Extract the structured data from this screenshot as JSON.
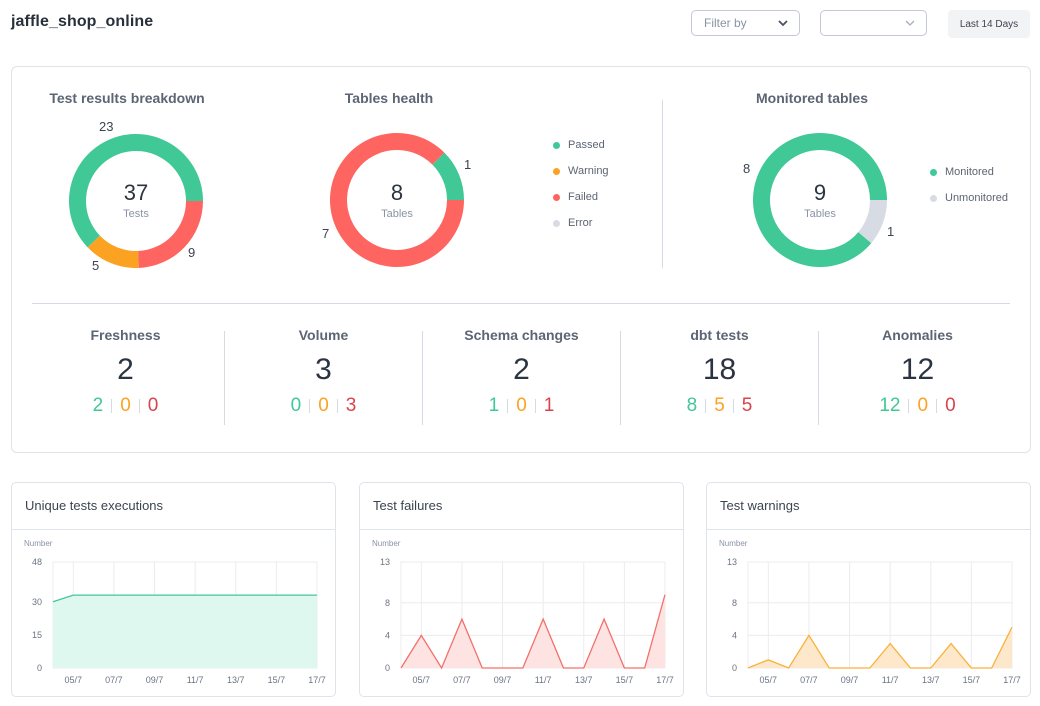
{
  "header": {
    "title": "jaffle_shop_online",
    "filter_placeholder": "Filter by",
    "second_select_value": "",
    "date_range_button": "Last 14 Days"
  },
  "colors": {
    "passed": "#40c896",
    "warning": "#fba223",
    "failed": "#fe6561",
    "error": "#d6dbe4",
    "unmonitored": "#d6dbe4",
    "stat_failed_text": "#d9434b"
  },
  "donuts": {
    "test_results": {
      "title": "Test results breakdown",
      "total": "37",
      "unit": "Tests",
      "segments": [
        {
          "name": "Passed",
          "value": 23,
          "label": "23"
        },
        {
          "name": "Failed",
          "value": 9,
          "label": "9"
        },
        {
          "name": "Warning",
          "value": 5,
          "label": "5"
        }
      ]
    },
    "tables_health": {
      "title": "Tables health",
      "total": "8",
      "unit": "Tables",
      "segments": [
        {
          "name": "Passed",
          "value": 1,
          "label": "1"
        },
        {
          "name": "Failed",
          "value": 7,
          "label": "7"
        }
      ],
      "legend": [
        "Passed",
        "Warning",
        "Failed",
        "Error"
      ]
    },
    "monitored_tables": {
      "title": "Monitored tables",
      "total": "9",
      "unit": "Tables",
      "segments": [
        {
          "name": "Monitored",
          "value": 8,
          "label": "8"
        },
        {
          "name": "Unmonitored",
          "value": 1,
          "label": "1"
        }
      ],
      "legend": [
        "Monitored",
        "Unmonitored"
      ]
    }
  },
  "stats": [
    {
      "title": "Freshness",
      "total": "2",
      "passed": "2",
      "warning": "0",
      "failed": "0"
    },
    {
      "title": "Volume",
      "total": "3",
      "passed": "0",
      "warning": "0",
      "failed": "3"
    },
    {
      "title": "Schema changes",
      "total": "2",
      "passed": "1",
      "warning": "0",
      "failed": "1"
    },
    {
      "title": "dbt tests",
      "total": "18",
      "passed": "8",
      "warning": "5",
      "failed": "5"
    },
    {
      "title": "Anomalies",
      "total": "12",
      "passed": "12",
      "warning": "0",
      "failed": "0"
    }
  ],
  "chart_data": [
    {
      "type": "area",
      "title": "Unique tests executions",
      "ylabel": "Number",
      "x": [
        "04/7",
        "05/7",
        "06/7",
        "07/7",
        "08/7",
        "09/7",
        "10/7",
        "11/7",
        "12/7",
        "13/7",
        "14/7",
        "15/7",
        "16/7",
        "17/7"
      ],
      "x_tick_labels": [
        "05/7",
        "07/7",
        "09/7",
        "11/7",
        "13/7",
        "15/7",
        "17/7"
      ],
      "y_ticks": [
        0,
        15,
        30,
        48
      ],
      "ylim": [
        0,
        48
      ],
      "values": [
        30,
        33,
        33,
        33,
        33,
        33,
        33,
        33,
        33,
        33,
        33,
        33,
        33,
        33
      ],
      "color": "#40c896",
      "fill": "#dff8ef",
      "grid": true
    },
    {
      "type": "area",
      "title": "Test failures",
      "ylabel": "Number",
      "x": [
        "04/7",
        "05/7",
        "06/7",
        "07/7",
        "08/7",
        "09/7",
        "10/7",
        "11/7",
        "12/7",
        "13/7",
        "14/7",
        "15/7",
        "16/7",
        "17/7"
      ],
      "x_tick_labels": [
        "05/7",
        "07/7",
        "09/7",
        "11/7",
        "13/7",
        "15/7",
        "17/7"
      ],
      "y_ticks": [
        0,
        4,
        8,
        13
      ],
      "ylim": [
        0,
        13
      ],
      "values": [
        0,
        4,
        0,
        6,
        0,
        0,
        0,
        6,
        0,
        0,
        6,
        0,
        0,
        9
      ],
      "color": "#f2706b",
      "fill": "#fde3e2",
      "grid": true
    },
    {
      "type": "area",
      "title": "Test warnings",
      "ylabel": "Number",
      "x": [
        "04/7",
        "05/7",
        "06/7",
        "07/7",
        "08/7",
        "09/7",
        "10/7",
        "11/7",
        "12/7",
        "13/7",
        "14/7",
        "15/7",
        "16/7",
        "17/7"
      ],
      "x_tick_labels": [
        "05/7",
        "07/7",
        "09/7",
        "11/7",
        "13/7",
        "15/7",
        "17/7"
      ],
      "y_ticks": [
        0,
        4,
        8,
        13
      ],
      "ylim": [
        0,
        13
      ],
      "values": [
        0,
        1,
        0,
        4,
        0,
        0,
        0,
        3,
        0,
        0,
        3,
        0,
        0,
        5
      ],
      "color": "#f9b13c",
      "fill": "#fde8cc",
      "grid": true
    }
  ]
}
